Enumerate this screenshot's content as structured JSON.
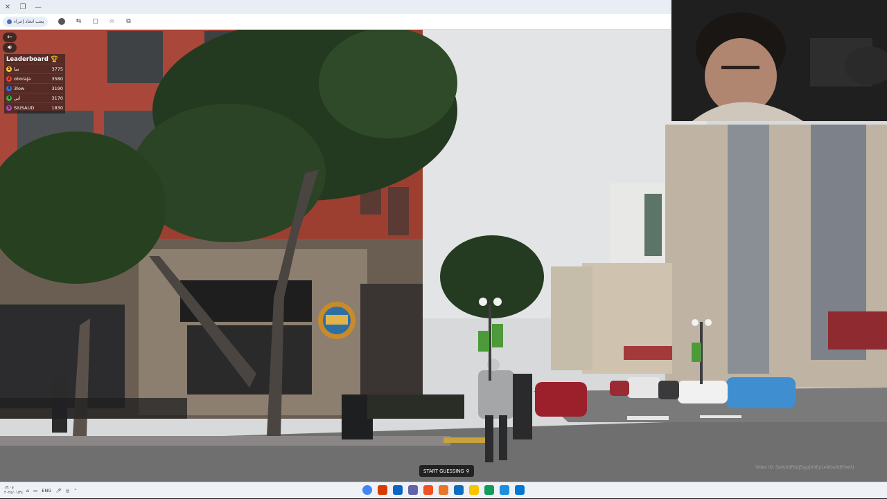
{
  "browser": {
    "address_chip": "يجب اتخاذ إجراء",
    "icons": [
      "close-icon",
      "restore-icon",
      "minimize-icon",
      "profile-icon",
      "extensions-icon",
      "sidebar-icon",
      "star-icon",
      "puzzle-icon"
    ]
  },
  "game": {
    "back_icon": "arrow-left-icon",
    "sound_icon": "speaker-icon",
    "leaderboard": {
      "title": "Leaderboard",
      "rows": [
        {
          "rank": "1",
          "name": "سا",
          "score": "3775",
          "color": "#f2c230"
        },
        {
          "rank": "2",
          "name": "oboraja",
          "score": "3580",
          "color": "#e2453c"
        },
        {
          "rank": "3",
          "name": "3low",
          "score": "3190",
          "color": "#3a6fd8"
        },
        {
          "rank": "4",
          "name": "أبي",
          "score": "3170",
          "color": "#3fb24f"
        },
        {
          "rank": "5",
          "name": "SIUSAUD",
          "score": "1830",
          "color": "#b04fd0"
        }
      ]
    },
    "start_button": "START GUESSING",
    "watermark": "Video ID: 5sdu5dFbUj5yg/JX0Ep1e9Dw3dF0wtU"
  },
  "taskbar": {
    "tray_left": [
      "١٣:٠٥",
      "٢٠٢٤/٠١/٢٤"
    ],
    "language": "ENG",
    "apps": [
      "chrome-icon",
      "app-icon",
      "store-icon",
      "teams-icon",
      "office-icon",
      "firefox-icon",
      "mail-icon",
      "folder-icon",
      "edge-icon",
      "photos-icon",
      "start-icon"
    ],
    "colors": {
      "chrome": "#4285f4",
      "red": "#d83b01",
      "blue": "#0a66c2",
      "purple": "#6264a7",
      "orange": "#f25022",
      "yellow": "#f8c400",
      "green": "#107c41",
      "teal": "#0f9d58"
    }
  }
}
